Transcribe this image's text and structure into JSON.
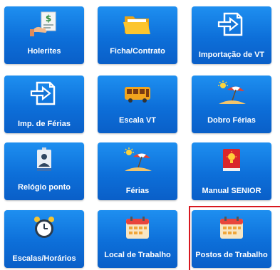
{
  "tiles": [
    {
      "label": "Holerites",
      "icon": "payslip-icon"
    },
    {
      "label": "Ficha/Contrato",
      "icon": "folder-icon"
    },
    {
      "label": "Importação de VT",
      "icon": "import-icon"
    },
    {
      "label": "Imp. de Férias",
      "icon": "import-icon"
    },
    {
      "label": "Escala VT",
      "icon": "bus-icon"
    },
    {
      "label": "Dobro Férias",
      "icon": "beach-icon"
    },
    {
      "label": "Relógio ponto",
      "icon": "timeclock-icon"
    },
    {
      "label": "Férias",
      "icon": "beach-icon"
    },
    {
      "label": "Manual SENIOR",
      "icon": "manual-icon"
    },
    {
      "label": "Escalas/Horários",
      "icon": "alarm-clock-icon"
    },
    {
      "label": "Local de Trabalho",
      "icon": "calendar-icon"
    },
    {
      "label": "Postos de Trabalho",
      "icon": "calendar-icon"
    }
  ],
  "colors": {
    "tile_top": "#1e8ff0",
    "tile_bottom": "#0a5fc8",
    "selection": "#d8181f"
  }
}
